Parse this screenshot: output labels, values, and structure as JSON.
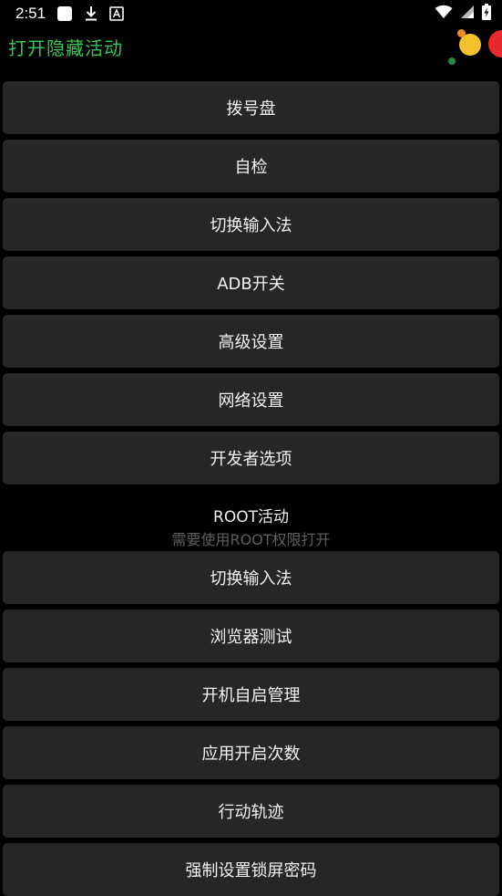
{
  "status_bar": {
    "time": "2:51",
    "icons_left": [
      "app-square-icon",
      "download-icon",
      "a-badge-icon"
    ],
    "icons_right": [
      "wifi-icon",
      "signal-icon",
      "battery-charging-icon"
    ]
  },
  "app_bar": {
    "title": "打开隐藏活动",
    "title_color": "#35c759"
  },
  "buttons_main": [
    {
      "label": "拨号盘"
    },
    {
      "label": "自检"
    },
    {
      "label": "切换输入法"
    },
    {
      "label": "ADB开关"
    },
    {
      "label": "高级设置"
    },
    {
      "label": "网络设置"
    },
    {
      "label": "开发者选项"
    }
  ],
  "root_section": {
    "title": "ROOT活动",
    "subtitle": "需要使用ROOT权限打开"
  },
  "buttons_root": [
    {
      "label": "切换输入法"
    },
    {
      "label": "浏览器测试"
    },
    {
      "label": "开机自启管理"
    },
    {
      "label": "应用开启次数"
    },
    {
      "label": "行动轨迹"
    },
    {
      "label": "强制设置锁屏密码"
    }
  ],
  "colors": {
    "background": "#000000",
    "button": "#262626",
    "accent_green": "#35c759"
  }
}
